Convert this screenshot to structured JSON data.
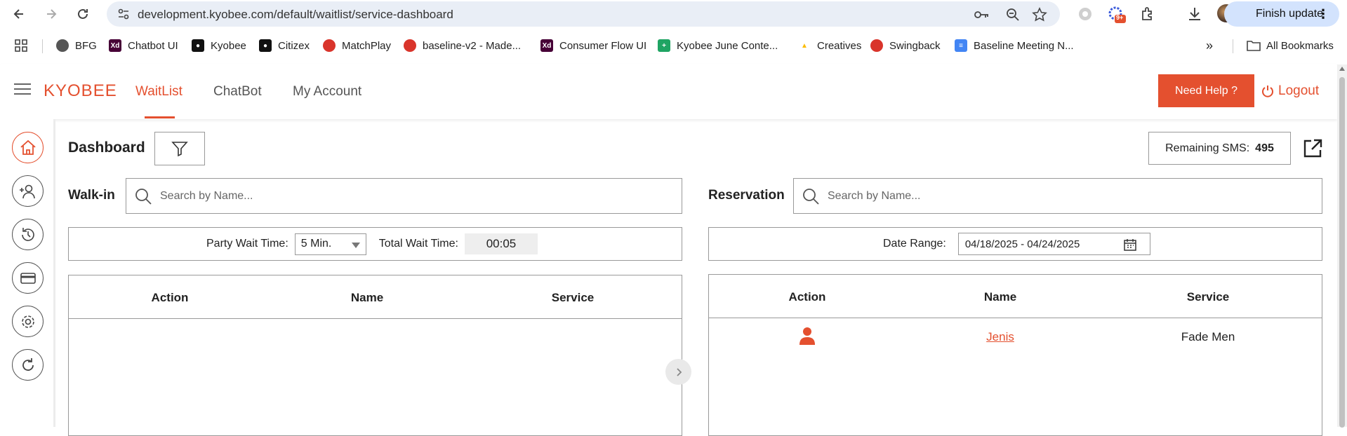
{
  "browser": {
    "url": "development.kyobee.com/default/waitlist/service-dashboard",
    "finish_update_label": "Finish update",
    "extension_badge": "9+"
  },
  "bookmarks": [
    {
      "label": "BFG",
      "icon": "bfg-favicon",
      "color": "#555555"
    },
    {
      "label": "Chatbot UI",
      "icon": "adobe-xd-icon",
      "color": "#470137"
    },
    {
      "label": "Kyobee",
      "icon": "github-icon",
      "color": "#111111"
    },
    {
      "label": "Citizex",
      "icon": "github-icon",
      "color": "#111111"
    },
    {
      "label": "MatchPlay",
      "icon": "matchplay-favicon",
      "color": "#d9342b"
    },
    {
      "label": "baseline-v2 - Made...",
      "icon": "made-favicon",
      "color": "#d9342b"
    },
    {
      "label": "Consumer Flow UI",
      "icon": "adobe-xd-icon",
      "color": "#470137"
    },
    {
      "label": "Kyobee June Conte...",
      "icon": "google-sheets-icon",
      "color": "#1fa463"
    },
    {
      "label": "Creatives",
      "icon": "google-drive-icon",
      "color": "#fbbc04"
    },
    {
      "label": "Swingback",
      "icon": "swingback-favicon",
      "color": "#d9342b"
    },
    {
      "label": "Baseline Meeting N...",
      "icon": "google-docs-icon",
      "color": "#4285f4"
    }
  ],
  "bookmarks_more": "»",
  "all_bookmarks_label": "All Bookmarks",
  "header": {
    "brand": "KYOBEE",
    "nav": [
      "WaitList",
      "ChatBot",
      "My Account"
    ],
    "active_nav": "WaitList",
    "need_help_label": "Need Help ?",
    "logout_label": "Logout"
  },
  "colors": {
    "accent": "#e4502f",
    "border": "#999999"
  },
  "sidebar": [
    "home-icon",
    "add-user-icon",
    "history-icon",
    "card-icon",
    "settings-icon",
    "refresh-icon"
  ],
  "dashboard": {
    "title": "Dashboard",
    "sms_label": "Remaining SMS:",
    "sms_value": "495"
  },
  "walkin": {
    "label": "Walk-in",
    "search_placeholder": "Search by Name...",
    "party_wait_label": "Party Wait Time:",
    "party_wait_value": "5 Min.",
    "total_wait_label": "Total Wait Time:",
    "total_wait_value": "00:05",
    "columns": [
      "Action",
      "Name",
      "Service"
    ],
    "rows": []
  },
  "reservation": {
    "label": "Reservation",
    "search_placeholder": "Search by Name...",
    "date_range_label": "Date Range:",
    "date_range_value": "04/18/2025 - 04/24/2025",
    "columns": [
      "Action",
      "Name",
      "Service"
    ],
    "rows": [
      {
        "action_icon": "person-icon",
        "name": "Jenis",
        "service": "Fade Men"
      }
    ]
  }
}
